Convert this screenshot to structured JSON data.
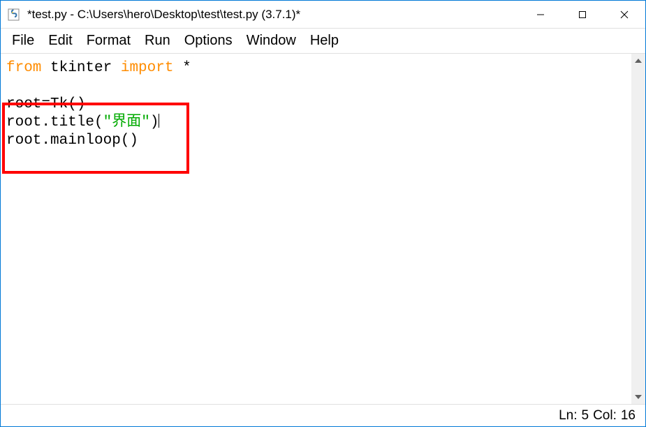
{
  "window": {
    "title": "*test.py - C:\\Users\\hero\\Desktop\\test\\test.py (3.7.1)*"
  },
  "menu": {
    "file": "File",
    "edit": "Edit",
    "format": "Format",
    "run": "Run",
    "options": "Options",
    "window": "Window",
    "help": "Help"
  },
  "code": {
    "line1_kw1": "from",
    "line1_txt1": " tkinter ",
    "line1_kw2": "import",
    "line1_txt2": " *",
    "line3": "root=Tk()",
    "line4_pre": "root.title(",
    "line4_str": "\"界面\"",
    "line4_post": ")",
    "line5": "root.mainloop()"
  },
  "highlight": {
    "top": "146",
    "left": "2",
    "width": "268",
    "height": "102"
  },
  "status": {
    "line_label": "Ln:",
    "line_value": "5",
    "col_label": "Col:",
    "col_value": "16"
  }
}
